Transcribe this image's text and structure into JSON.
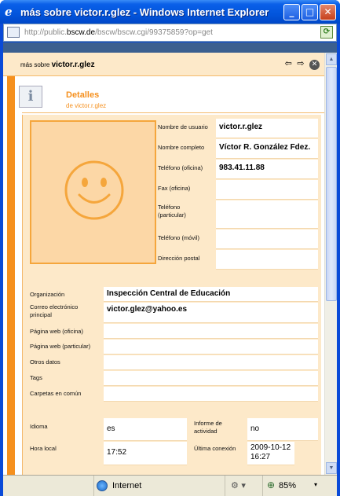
{
  "window": {
    "title": "más sobre victor.r.glez - Windows Internet Explorer",
    "minimize": "_",
    "maximize": "□",
    "close": "✕"
  },
  "address": {
    "prefix": "http://public.",
    "host": "bscw.de",
    "path": "/bscw/bscw.cgi/99375859?op=get"
  },
  "header": {
    "label_small": "más sobre ",
    "label_name": "victor.r.glez"
  },
  "details": {
    "title": "Detalles",
    "subtitle": "de victor.r.glez"
  },
  "user": {
    "fields": [
      {
        "label": "Nombre de usuario",
        "value": "victor.r.glez"
      },
      {
        "label": "Nombre completo",
        "value": "Víctor R. González Fdez."
      },
      {
        "label": "Teléfono (oficina)",
        "value": "983.41.11.88"
      },
      {
        "label": "Fax (oficina)",
        "value": ""
      },
      {
        "label": "Teléfono (particular)",
        "value": ""
      },
      {
        "label": "Teléfono (móvil)",
        "value": ""
      },
      {
        "label": "Dirección postal",
        "value": ""
      }
    ]
  },
  "org": {
    "fields": [
      {
        "label": "Organización",
        "value": "Inspección Central de Educación"
      },
      {
        "label": "Correo electrónico principal",
        "value": "victor.glez@yahoo.es"
      },
      {
        "label": "Página web (oficina)",
        "value": ""
      },
      {
        "label": "Página web (particular)",
        "value": ""
      },
      {
        "label": "Otros datos",
        "value": ""
      },
      {
        "label": "Tags",
        "value": ""
      },
      {
        "label": "Carpetas en común",
        "value": ""
      }
    ]
  },
  "prefs": {
    "idioma_label": "Idioma",
    "idioma": "es",
    "informe_label": "Informe de actividad",
    "informe": "no",
    "hora_label": "Hora local",
    "hora": "17:52",
    "ultima_label": "Última conexión",
    "ultima": "2009-10-12 16:27"
  },
  "status": {
    "zone": "Internet",
    "zoom": "85%"
  },
  "colors": {
    "accent": "#f5901e",
    "panel": "#fde9c9",
    "avatar_bg": "#fcd7a6",
    "titlebar": "#0255dc"
  }
}
